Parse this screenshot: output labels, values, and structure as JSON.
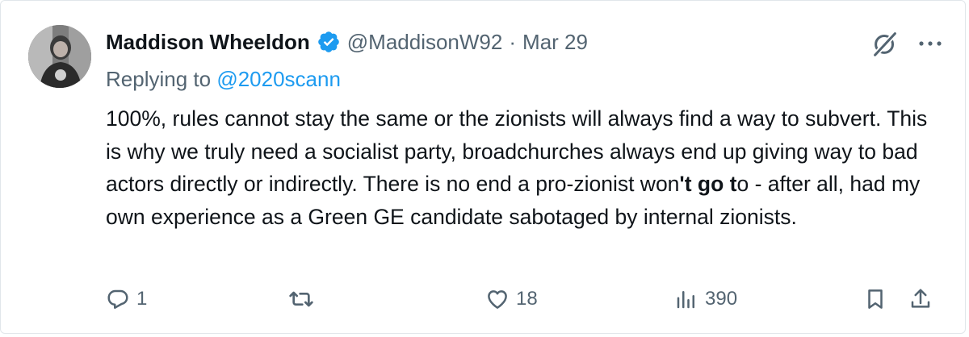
{
  "tweet": {
    "author_name": "Maddison Wheeldon",
    "handle": "@MaddisonW92",
    "separator": "·",
    "date": "Mar 29",
    "replying_prefix": "Replying to ",
    "replying_to": "@2020scann",
    "body": {
      "part1": "100%, rules cannot stay the same or the zionists will always find a way to subvert. This is why we truly need a socialist party, broadchurches always end up giving way to bad actors directly or indirectly. There is no end a pro-zionist won",
      "bold1": "'t go t",
      "part2": "o - after all, had my own experience as a Green GE candidate sabotaged by internal zionists."
    }
  },
  "actions": {
    "reply_count": "1",
    "retweet_count": "",
    "like_count": "18",
    "views_count": "390"
  },
  "icons": {
    "verified": "verified-badge-icon",
    "grok": "grok-icon",
    "more": "more-icon",
    "reply": "reply-icon",
    "retweet": "retweet-icon",
    "like": "heart-icon",
    "views": "views-icon",
    "bookmark": "bookmark-icon",
    "share": "share-icon"
  },
  "colors": {
    "accent": "#1d9bf0",
    "secondary_text": "#536471",
    "primary_text": "#0f1419"
  }
}
